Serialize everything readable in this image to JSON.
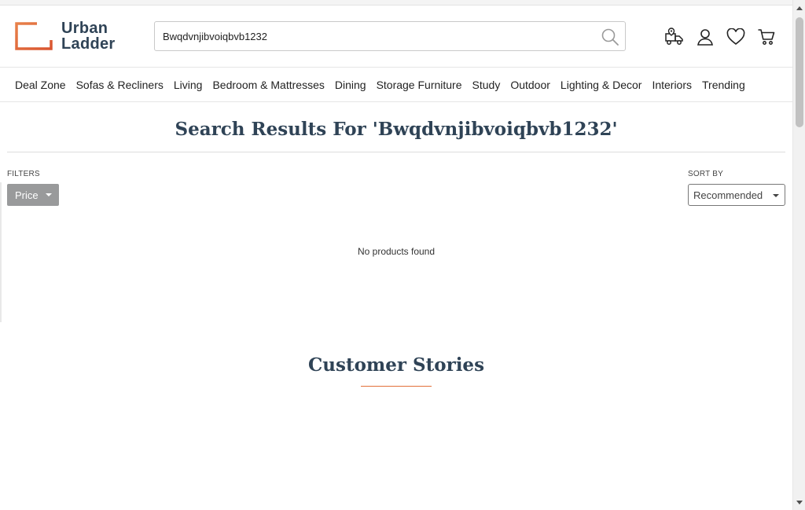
{
  "brand": {
    "line1": "Urban",
    "line2": "Ladder",
    "accent_color": "#e2703a",
    "text_color": "#2f4356"
  },
  "search": {
    "value": "Bwqdvnjibvoiqbvb1232",
    "icon": "search-icon"
  },
  "header_icons": [
    "delivery-truck-icon",
    "user-account-icon",
    "wishlist-heart-icon",
    "shopping-cart-icon"
  ],
  "nav": {
    "items": [
      {
        "label": "Deal Zone"
      },
      {
        "label": "Sofas & Recliners"
      },
      {
        "label": "Living"
      },
      {
        "label": "Bedroom & Mattresses"
      },
      {
        "label": "Dining"
      },
      {
        "label": "Storage Furniture"
      },
      {
        "label": "Study"
      },
      {
        "label": "Outdoor"
      },
      {
        "label": "Lighting & Decor"
      },
      {
        "label": "Interiors"
      },
      {
        "label": "Trending"
      }
    ]
  },
  "results": {
    "title": "Search Results For 'Bwqdvnjibvoiqbvb1232'",
    "filters_label": "FILTERS",
    "price_filter_label": "Price",
    "sort_label": "SORT BY",
    "sort_value": "Recommended",
    "empty_message": "No products found"
  },
  "stories": {
    "title": "Customer Stories"
  }
}
